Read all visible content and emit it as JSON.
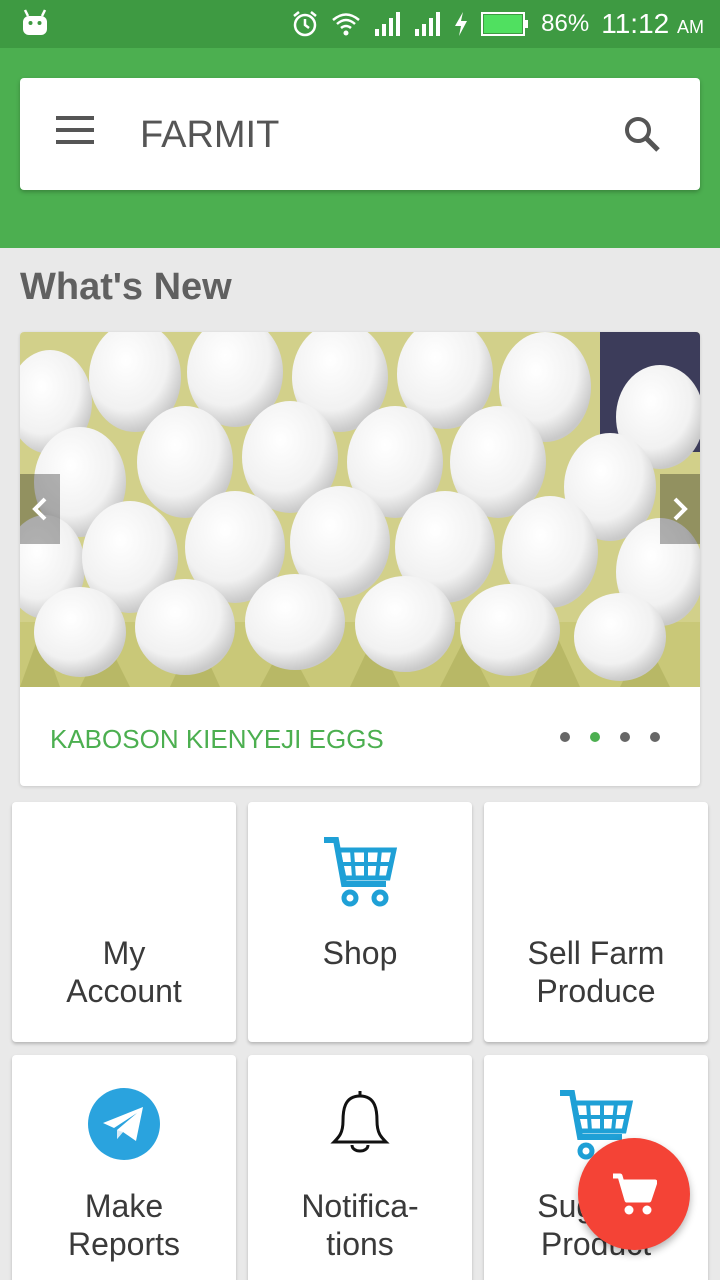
{
  "status_bar": {
    "battery_percent": "86%",
    "time": "11:12",
    "ampm": "AM",
    "icons": [
      "android-icon",
      "alarm-icon",
      "wifi-icon",
      "signal-icon",
      "signal-icon",
      "charging-icon",
      "battery-icon"
    ]
  },
  "app_bar": {
    "title": "FARMIT",
    "menu_icon": "hamburger-menu-icon",
    "search_icon": "search-icon",
    "color": "#4caf50"
  },
  "whats_new": {
    "title": "What's New",
    "slide_caption": "KABOSON KIENYEJI EGGS",
    "slide_count": 4,
    "active_slide": 2,
    "caption_color": "#4caf50"
  },
  "tiles": [
    {
      "label_line1": "My",
      "label_line2": "Account",
      "icon": "none"
    },
    {
      "label_line1": "Shop",
      "label_line2": "",
      "icon": "shopping-cart-icon"
    },
    {
      "label_line1": "Sell Farm",
      "label_line2": "Produce",
      "icon": "none"
    },
    {
      "label_line1": "Make",
      "label_line2": "Reports",
      "icon": "telegram-icon"
    },
    {
      "label_line1": "Notifica-",
      "label_line2": "tions",
      "icon": "bell-icon"
    },
    {
      "label_line1": "Suggest",
      "label_line2": "Product",
      "icon": "shopping-cart-icon"
    }
  ],
  "fab": {
    "icon": "cart-icon",
    "color": "#f44336"
  }
}
